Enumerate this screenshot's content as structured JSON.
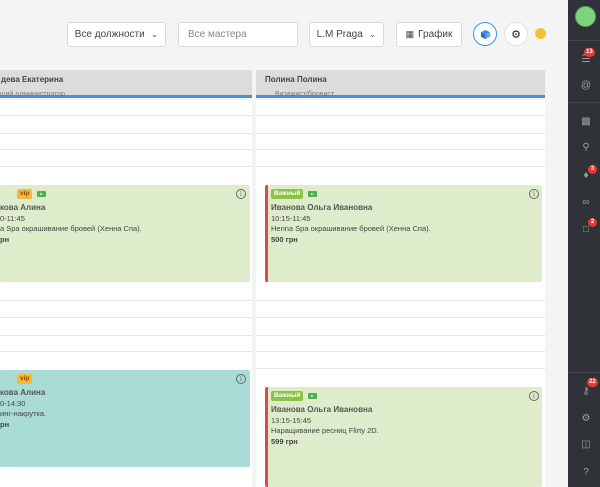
{
  "toolbar": {
    "positions_select": "Все должности",
    "master_placeholder": "Все мастера",
    "location_select": "L.M Praga",
    "schedule_button": "График"
  },
  "columns": [
    {
      "name": "дева Екатерина",
      "role": "рший администратор"
    },
    {
      "name": "Полина Полина",
      "role": "Визажист/бровист"
    }
  ],
  "appointments": [
    {
      "badge": "vip",
      "client": "кова Алина",
      "time": "0-11:45",
      "service": "a Spa окрашивание бровей (Хенна Спа).",
      "price": "рн"
    },
    {
      "badge": "Важный",
      "client": "Иванова Ольга Ивановна",
      "time": "10:15-11:45",
      "service": "Henna Spa окрашивание бровей (Хенна Спа).",
      "price": "500 грн"
    },
    {
      "badge": "vip",
      "client": "кова Алина",
      "time": "0-14:30",
      "service": "инг-накрутка.",
      "price": "рн"
    },
    {
      "badge": "Важный",
      "client": "Иванова Ольга Ивановна",
      "time": "13:15-15:45",
      "service": "Наращивание ресниц Flirty 2D.",
      "price": "599 грн"
    }
  ],
  "sidebar": {
    "badges": [
      "13",
      "3",
      "2",
      "22"
    ]
  },
  "colors": {
    "accent": "#4a8fd8",
    "card_green": "#deeccc",
    "card_teal": "#a9dcd6",
    "important_bar": "#d94a4a",
    "sidebar_bg": "#2f3338"
  }
}
